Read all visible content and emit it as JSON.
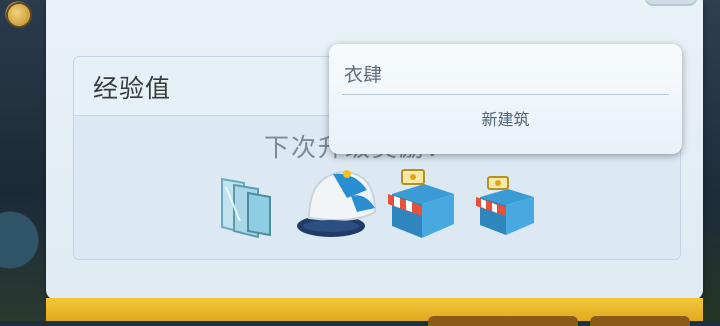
{
  "experience_panel": {
    "title": "经验值",
    "next_label": "下次升级奖励："
  },
  "popup": {
    "name": "衣肆",
    "subtitle": "新建筑"
  },
  "rewards": [
    {
      "icon": "glass-panels-icon"
    },
    {
      "icon": "baseball-cap-icon"
    },
    {
      "icon": "shop-stall-icon"
    },
    {
      "icon": "shop-stall-small-icon"
    }
  ],
  "colors": {
    "panel": "#e9f2f7",
    "accent_gold": "#f4c73a",
    "text_dark": "#3a3a3a"
  }
}
